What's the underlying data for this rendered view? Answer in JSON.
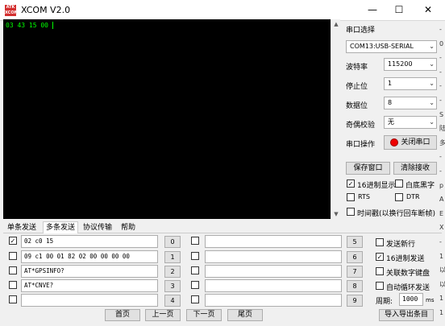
{
  "window": {
    "logo_text": "ATK XCOM",
    "title": "XCOM V2.0",
    "minimize": "—",
    "maximize": "☐",
    "close": "✕"
  },
  "terminal": {
    "text": "03 43 15 00 "
  },
  "serial": {
    "port_label": "串口选择",
    "port_value": "COM13:USB-SERIAL",
    "baud_label": "波特率",
    "baud_value": "115200",
    "stop_label": "停止位",
    "stop_value": "1",
    "data_label": "数据位",
    "data_value": "8",
    "parity_label": "奇偶校验",
    "parity_value": "无",
    "op_label": "串口操作",
    "op_button": "关闭串口"
  },
  "right_panel": {
    "save_button": "保存窗口",
    "clear_button": "清除接收",
    "hex_display": "16进制显示",
    "white_bg": "白底黑字",
    "rts": "RTS",
    "dtr": "DTR",
    "timestamp": "时间戳(以换行回车断帧)"
  },
  "tabs": [
    "单条发送",
    "多条发送",
    "协议传输",
    "帮助"
  ],
  "multi_rows": [
    {
      "checked": true,
      "value": "02 c0 15",
      "num": "0"
    },
    {
      "checked": false,
      "value": "09 c1 00 01 82 02 00 00 00 00",
      "num": "1"
    },
    {
      "checked": false,
      "value": "AT*GPSINFO?",
      "num": "2"
    },
    {
      "checked": false,
      "value": "AT*CNVE?",
      "num": "3"
    },
    {
      "checked": false,
      "value": "",
      "num": "4"
    }
  ],
  "multi_rows_b": [
    {
      "value": "",
      "num": "5"
    },
    {
      "value": "",
      "num": "6"
    },
    {
      "value": "",
      "num": "7"
    },
    {
      "value": "",
      "num": "8"
    },
    {
      "value": "",
      "num": "9"
    }
  ],
  "send_opts": {
    "newline": "发送新行",
    "hex_send": "16进制发送",
    "numkeypad": "关联数字键盘",
    "loop": "自动循环发送",
    "period_label": "周期:",
    "period_value": "1000",
    "period_unit": "ms"
  },
  "pager": {
    "first": "首页",
    "prev": "上一页",
    "next": "下一页",
    "last": "尾页",
    "import": "导入导出条目"
  },
  "edge_chars": [
    "-",
    "0",
    "-",
    "-",
    "-",
    "-",
    "S",
    "陆",
    "多",
    "-",
    "-",
    "p",
    "A",
    "E",
    "X",
    "-",
    "1",
    "以",
    "以",
    "1",
    "1"
  ]
}
